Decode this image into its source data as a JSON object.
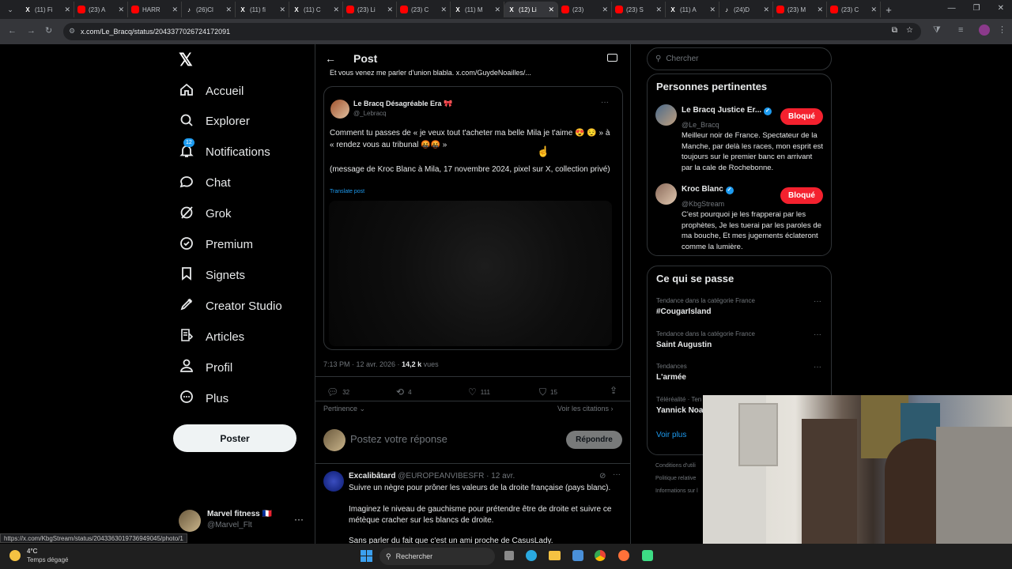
{
  "browser": {
    "tabs": [
      {
        "icon": "x-icon",
        "title": "(11) Fi",
        "color": "#fff"
      },
      {
        "icon": "youtube-icon",
        "title": "(23) A",
        "color": "#ff0000"
      },
      {
        "icon": "youtube-icon",
        "title": "HARR",
        "color": "#ff0000"
      },
      {
        "icon": "tiktok-icon",
        "title": "(26)Cl",
        "color": "#fff"
      },
      {
        "icon": "x-icon",
        "title": "(11) fi",
        "color": "#fff"
      },
      {
        "icon": "x-icon",
        "title": "(11) C",
        "color": "#fff"
      },
      {
        "icon": "youtube-icon",
        "title": "(23) Li",
        "color": "#ff0000"
      },
      {
        "icon": "youtube-icon",
        "title": "(23) C",
        "color": "#ff0000"
      },
      {
        "icon": "x-icon",
        "title": "(11) M",
        "color": "#fff"
      },
      {
        "icon": "x-icon",
        "title": "(12) Li",
        "color": "#fff",
        "active": true
      },
      {
        "icon": "youtube-icon",
        "title": "(23)",
        "color": "#ff0000"
      },
      {
        "icon": "youtube-icon",
        "title": "(23) S",
        "color": "#ff0000"
      },
      {
        "icon": "x-icon",
        "title": "(11) A",
        "color": "#fff"
      },
      {
        "icon": "tiktok-icon",
        "title": "(24)D",
        "color": "#fff"
      },
      {
        "icon": "youtube-icon",
        "title": "(23) M",
        "color": "#ff0000"
      },
      {
        "icon": "youtube-icon",
        "title": "(23) C",
        "color": "#ff0000"
      }
    ],
    "url": "x.com/Le_Bracq/status/2043377026724172091",
    "status_url": "https://x.com/KbgStream/status/2043363019736949045/photo/1"
  },
  "nav": {
    "items": [
      "Accueil",
      "Explorer",
      "Notifications",
      "Chat",
      "Grok",
      "Premium",
      "Signets",
      "Creator Studio",
      "Articles",
      "Profil",
      "Plus"
    ],
    "notif_badge": "12",
    "post_button": "Poster",
    "account": {
      "name": "Marvel fitness 🇫🇷",
      "handle": "@Marvel_Flt"
    }
  },
  "header": {
    "title": "Post"
  },
  "top_cut_text": "Et vous venez me parler d'union blabla. x.com/GuydeNoailles/...",
  "quoted": {
    "author": "Le Bracq Désagréable Era 🎀",
    "handle": "@_Lebracq",
    "text1": "Comment tu passes de « je veux tout t'acheter ma belle Mila je t'aime 😍 😌 » à « rendez vous au tribunal 🤬🤬 »",
    "text2": "(message de Kroc Blanc à Mila, 17 novembre 2024, pixel sur X, collection privé)",
    "translate": "Translate post"
  },
  "meta": {
    "time": "7:13 PM · 12 avr. 2026 · ",
    "views": "14,2 k",
    "views_label": " vues"
  },
  "actions": {
    "replies": "32",
    "reposts": "4",
    "likes": "111",
    "bookmarks": "15"
  },
  "sort": {
    "label": "Pertinence",
    "quotes": "Voir les citations"
  },
  "reply_box": {
    "placeholder": "Postez votre réponse",
    "button": "Répondre"
  },
  "reply": {
    "name": "Excalibâtard",
    "handle": "@EUROPEANVIBESFR · 12 avr.",
    "p1": "Suivre un nègre pour prôner les valeurs de la droite française (pays blanc).",
    "p2": "Imaginez le niveau de gauchisme pour prétendre être de droite et suivre ce métèque cracher sur les blancs de droite.",
    "p3": "Sans parler du fait que c'est un ami proche de CasusLady."
  },
  "search": {
    "placeholder": "Chercher"
  },
  "relevant": {
    "title": "Personnes pertinentes",
    "people": [
      {
        "name": "Le Bracq Justice Er...",
        "handle": "@Le_Bracq",
        "button": "Bloqué",
        "bio": "Meilleur noir de France. Spectateur de la Manche, par delà les races, mon esprit est toujours sur le premier banc en arrivant par la cale de Rochebonne."
      },
      {
        "name": "Kroc Blanc",
        "handle": "@KbgStream",
        "button": "Bloqué",
        "bio": "C'est pourquoi je les frapperai par les prophètes, Je les tuerai par les paroles de ma bouche, Et mes jugements éclateront comme la lumière."
      }
    ]
  },
  "trends": {
    "title": "Ce qui se passe",
    "items": [
      {
        "context": "Tendance dans la catégorie France",
        "name": "#CougarIsland"
      },
      {
        "context": "Tendance dans la catégorie France",
        "name": "Saint Augustin"
      },
      {
        "context": "Tendances",
        "name": "L'armée"
      },
      {
        "context": "Téléréalité · Ten",
        "name": "Yannick Noa"
      }
    ],
    "show_more": "Voir plus"
  },
  "footer_links": [
    "Conditions d'utili",
    "Politique relative",
    "Informations sur l"
  ],
  "taskbar": {
    "temp": "4°C",
    "weather": "Temps dégagé",
    "search": "Rechercher"
  },
  "colors": {
    "accent": "#1d9bf0",
    "block": "#f4212e",
    "bg": "#000000",
    "border": "#2f3336",
    "muted": "#71767b"
  }
}
